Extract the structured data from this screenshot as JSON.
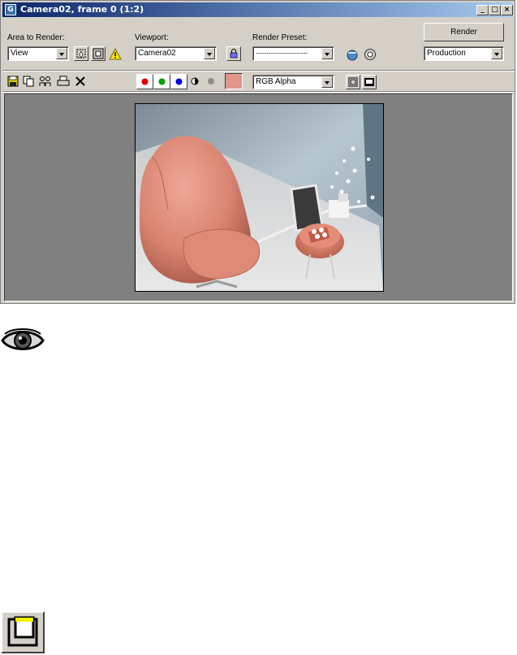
{
  "window": {
    "title": "Camera02, frame 0 (1:2)"
  },
  "area_to_render": {
    "label": "Area to Render:",
    "value": "View"
  },
  "viewport": {
    "label": "Viewport:",
    "value": "Camera02"
  },
  "render_preset": {
    "label": "Render Preset:",
    "value": "------------------------"
  },
  "render_button": {
    "label": "Render"
  },
  "quality_select": {
    "value": "Production"
  },
  "channel_select": {
    "value": "RGB Alpha"
  },
  "colors": {
    "swatch": "#e0968a",
    "red": "#e00000",
    "green": "#00a000",
    "blue": "#0000e0"
  }
}
